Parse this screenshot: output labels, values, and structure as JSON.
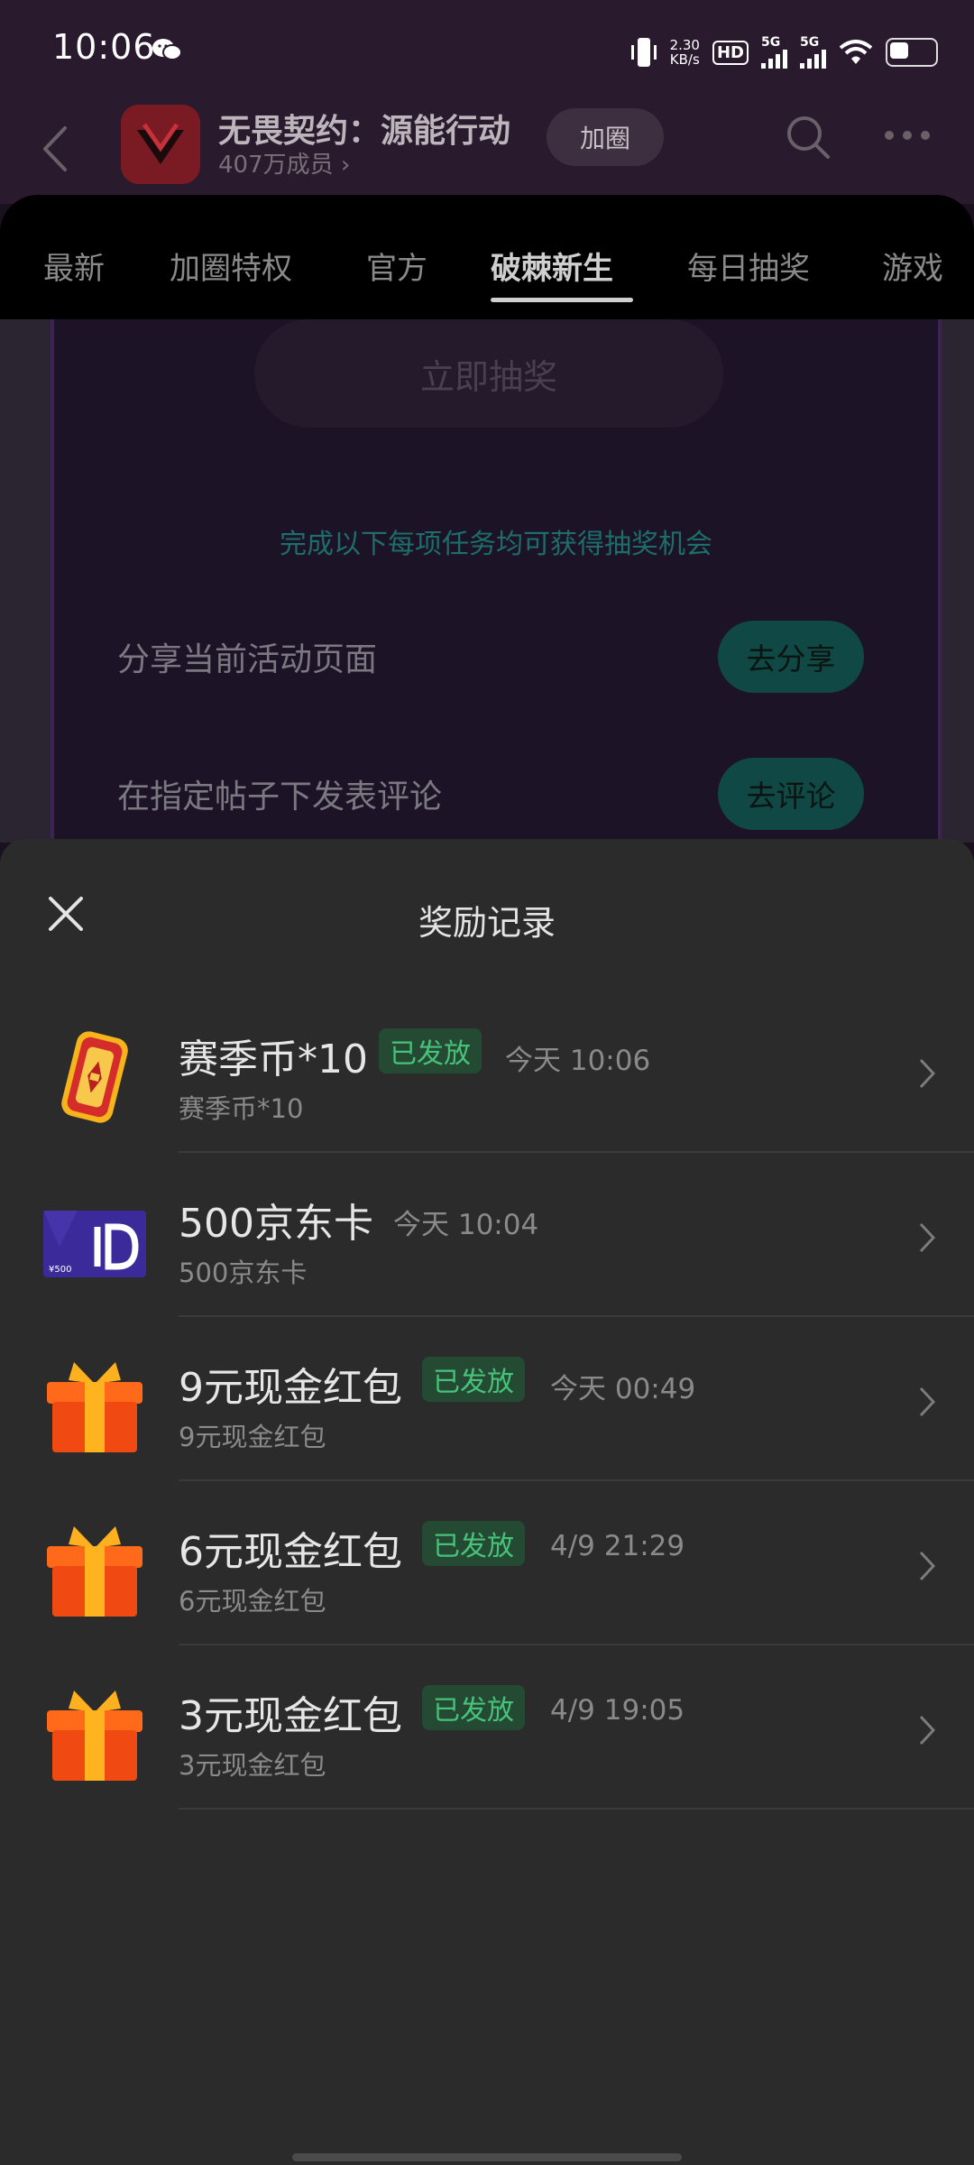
{
  "status_bar": {
    "time": "10:06",
    "net_speed_value": "2.30",
    "net_speed_unit": "KB/s",
    "hd_label": "HD",
    "sim1_label": "5G",
    "sim2_label": "5G",
    "icons": [
      "wechat-icon",
      "vibrate-icon",
      "wifi-icon",
      "battery-icon"
    ]
  },
  "header": {
    "circle_name": "无畏契约：源能行动",
    "members": "407万成员",
    "join_label": "加圈"
  },
  "tabs": [
    {
      "label": "最新"
    },
    {
      "label": "加圈特权"
    },
    {
      "label": "官方"
    },
    {
      "label": "破棘新生",
      "active": true
    },
    {
      "label": "每日抽奖"
    },
    {
      "label": "游戏"
    }
  ],
  "activity": {
    "draw_button": "立即抽奖",
    "hint": "完成以下每项任务均可获得抽奖机会",
    "tasks": [
      {
        "label": "分享当前活动页面",
        "button": "去分享"
      },
      {
        "label": "在指定帖子下发表评论",
        "button": "去评论"
      }
    ]
  },
  "sheet": {
    "title": "奖励记录",
    "records": [
      {
        "name": "赛季币*10",
        "status": "已发放",
        "time": "今天 10:06",
        "sub": "赛季币*10",
        "icon": "season-coin-icon"
      },
      {
        "name": "500京东卡",
        "status": "",
        "time": "今天 10:04",
        "sub": "500京东卡",
        "icon": "jd-card-icon",
        "icon_text": "¥500"
      },
      {
        "name": "9元现金红包",
        "status": "已发放",
        "time": "今天 00:49",
        "sub": "9元现金红包",
        "icon": "gift-box-icon"
      },
      {
        "name": "6元现金红包",
        "status": "已发放",
        "time": "4/9 21:29",
        "sub": "6元现金红包",
        "icon": "gift-box-icon"
      },
      {
        "name": "3元现金红包",
        "status": "已发放",
        "time": "4/9 19:05",
        "sub": "3元现金红包",
        "icon": "gift-box-icon"
      }
    ]
  },
  "colors": {
    "sheet_bg": "#2b2b2b",
    "status_green": "#48c27a",
    "task_button": "#0f4844"
  }
}
